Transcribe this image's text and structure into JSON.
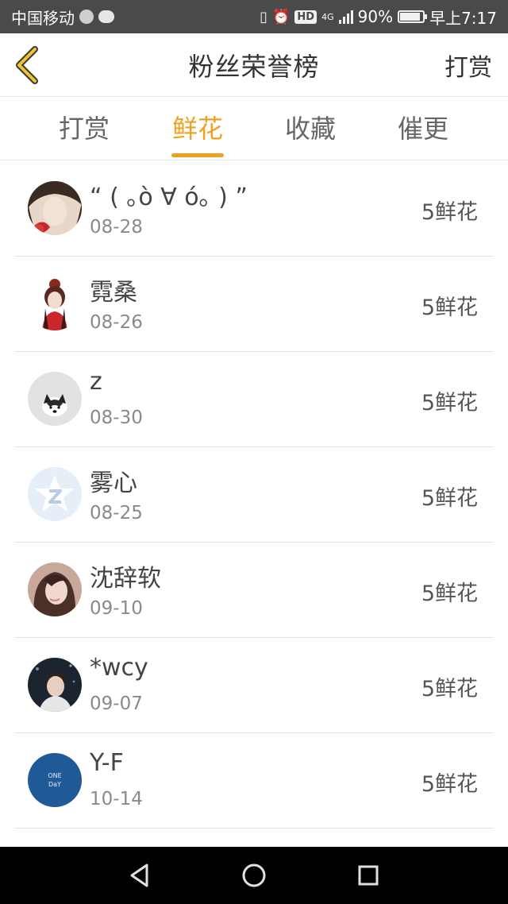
{
  "status_bar": {
    "carrier": "中国移动",
    "hd_label": "HD",
    "network": "4G",
    "battery": "90%",
    "battery_level": 0.9,
    "time": "早上7:17"
  },
  "header": {
    "title": "粉丝荣誉榜",
    "right_action": "打赏",
    "accent_color": "#f0a020"
  },
  "tabs": [
    {
      "label": "打赏",
      "active": false
    },
    {
      "label": "鲜花",
      "active": true
    },
    {
      "label": "收藏",
      "active": false
    },
    {
      "label": "催更",
      "active": false
    }
  ],
  "list": [
    {
      "name": "“ ( ｡ò ∀ ó｡ ) ”",
      "date": "08-28",
      "amount": "5鲜花"
    },
    {
      "name": "霓桑",
      "date": "08-26",
      "amount": "5鲜花"
    },
    {
      "name": "z",
      "date": "08-30",
      "amount": "5鲜花"
    },
    {
      "name": "雾心",
      "date": "08-25",
      "amount": "5鲜花"
    },
    {
      "name": "沈辞软",
      "date": "09-10",
      "amount": "5鲜花"
    },
    {
      "name": "*wcy",
      "date": "09-07",
      "amount": "5鲜花"
    },
    {
      "name": "Y-F",
      "date": "10-14",
      "amount": "5鲜花"
    }
  ],
  "avatar_texts": {
    "one_day_line1": "ONE",
    "one_day_line2": "DaY"
  }
}
